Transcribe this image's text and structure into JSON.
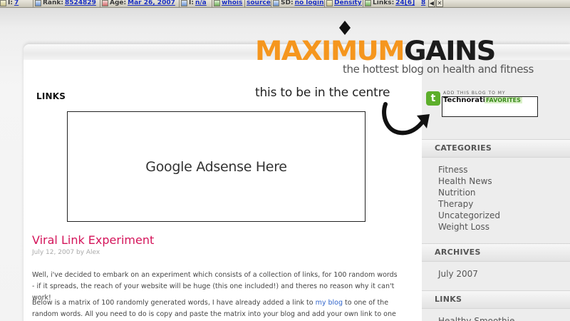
{
  "toolbar": {
    "items": [
      {
        "label": "I:",
        "value": "7"
      },
      {
        "label": "Rank:",
        "value": "8524829"
      },
      {
        "label": "Age:",
        "value": "Mar 26, 2007"
      },
      {
        "label": "I:",
        "value": "n/a"
      },
      {
        "label": "",
        "value": "whois"
      },
      {
        "label": "",
        "value": "source"
      },
      {
        "label": "SD:",
        "value": "no login"
      },
      {
        "label": "",
        "value": "Density"
      },
      {
        "label": "Links:",
        "value": "24[6]"
      },
      {
        "label": "",
        "value": "8"
      }
    ],
    "controls": [
      "◀",
      "✕"
    ]
  },
  "header": {
    "logo_left": "MAXIMUM",
    "logo_right": "GAINS",
    "tagline": "the hottest blog on health and fitness",
    "note": "this to be in the centre"
  },
  "main": {
    "links_heading": "LINKS",
    "ad_placeholder": "Google Adsense Here",
    "post": {
      "title": "Viral Link Experiment",
      "meta": "July 12, 2007 by Alex",
      "p1": "Well, i've decided to embark on an experiment which consists of a collection of links, for 100 random words - if it spreads, the reach of your website will be huge (this one included!) and theres no reason why it can't work!",
      "p2_before": "Below is a matrix of 100 randomly generated words, I have already added a link to ",
      "p2_link": "my blog",
      "p2_after": " to one of the random words. All you need to do is copy and paste the matrix into your blog and add your own link to one of"
    }
  },
  "sidebar": {
    "technorati": {
      "small": "ADD THIS BLOG TO MY",
      "brand": "Technorati",
      "fav": "FAVORITES"
    },
    "categories_heading": "CATEGORIES",
    "categories": [
      "Fitness",
      "Health News",
      "Nutrition",
      "Therapy",
      "Uncategorized",
      "Weight Loss"
    ],
    "archives_heading": "ARCHIVES",
    "archives": [
      "July 2007"
    ],
    "links_heading": "LINKS",
    "links": [
      "Healthy Smoothie"
    ]
  },
  "colors": {
    "accent": "#f5961e",
    "post_title": "#d4145a",
    "link": "#3366cc"
  }
}
